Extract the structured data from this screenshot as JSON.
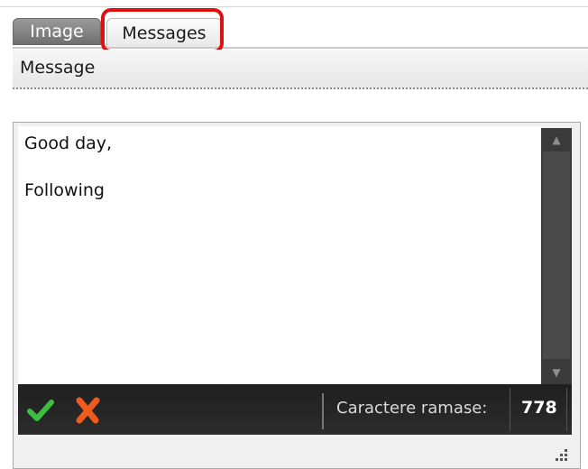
{
  "tabs": [
    {
      "label": "Image",
      "active": false
    },
    {
      "label": "Messages",
      "active": true
    }
  ],
  "section": {
    "title": "Message"
  },
  "editor": {
    "lines": [
      "Good day,",
      "Following"
    ]
  },
  "toolbar": {
    "confirm_icon": "checkmark-icon",
    "cancel_icon": "x-cancel-icon",
    "counter_label": "Caractere ramase:",
    "counter_value": "778"
  },
  "colors": {
    "highlight": "#e01010",
    "confirm": "#3cbf3c",
    "cancel": "#f05a1e",
    "toolbar_bg": "#262626"
  }
}
